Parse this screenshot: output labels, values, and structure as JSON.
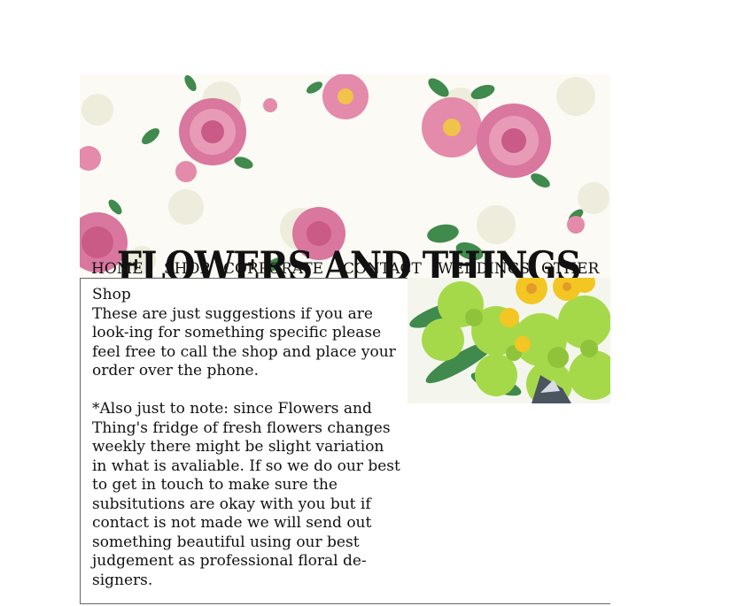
{
  "header": {
    "title": "FLOWERS AND THINGS",
    "banner_image": "floral-pattern-banner"
  },
  "nav": {
    "items": [
      {
        "label": "HOME"
      },
      {
        "label": "SHOP"
      },
      {
        "label": "CORPORATE"
      },
      {
        "label": "CONTACT"
      },
      {
        "label": "WEDDINGS"
      },
      {
        "label": "OTHER"
      }
    ]
  },
  "content": {
    "heading": "Shop",
    "paragraph1": "These are just suggestions if you are look-ing for something specific please feel free to call the shop and place your order over the phone.",
    "paragraph2": "*Also just to note: since Flowers and Thing's fridge of fresh flowers changes weekly there might be slight variation in what is avaliable. If so we do our best to get in touch to make sure the subsitutions are okay with you but if contact is not made we will send out something beautiful using our best judgement as professional floral de-signers."
  },
  "photo": {
    "image": "green-yellow-flower-arrangement"
  },
  "colors": {
    "rose_pink": "#d9779e",
    "leaf_green": "#3f8a4c",
    "lime_green": "#a6d94a",
    "yellow": "#f3c623"
  }
}
